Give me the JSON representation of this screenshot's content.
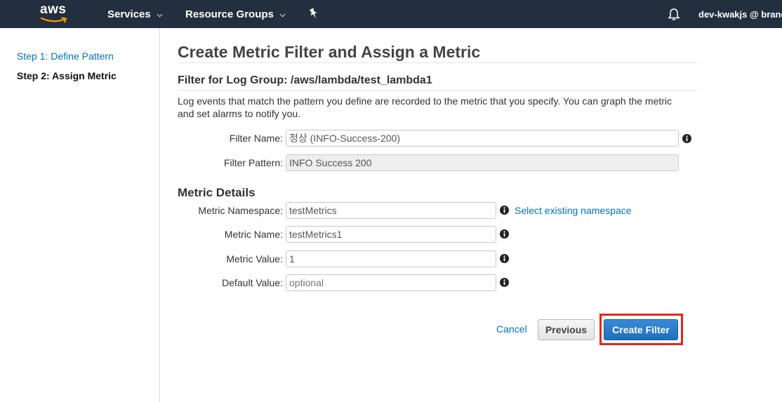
{
  "topnav": {
    "logo_text": "aws",
    "services_label": "Services",
    "resource_groups_label": "Resource Groups",
    "caret": "⌄",
    "account_label": "dev-kwakjs @ brand"
  },
  "sidebar": {
    "steps": [
      {
        "label": "Step 1: Define Pattern",
        "active": false
      },
      {
        "label": "Step 2: Assign Metric",
        "active": true
      }
    ]
  },
  "main": {
    "title": "Create Metric Filter and Assign a Metric",
    "subtitle": "Filter for Log Group: /aws/lambda/test_lambda1",
    "description": "Log events that match the pattern you define are recorded to the metric that you specify. You can graph the metric and set alarms to notify you.",
    "filter_name": {
      "label": "Filter Name:",
      "value": "정상 (INFO-Success-200)"
    },
    "filter_pattern": {
      "label": "Filter Pattern:",
      "value": "INFO Success 200"
    },
    "metric_details_title": "Metric Details",
    "metric_namespace": {
      "label": "Metric Namespace:",
      "value": "testMetrics",
      "link": "Select existing namespace"
    },
    "metric_name": {
      "label": "Metric Name:",
      "value": "testMetrics1"
    },
    "metric_value": {
      "label": "Metric Value:",
      "value": "1"
    },
    "default_value": {
      "label": "Default Value:",
      "value": "",
      "placeholder": "optional"
    }
  },
  "actions": {
    "cancel_label": "Cancel",
    "previous_label": "Previous",
    "create_label": "Create Filter",
    "highlight_color": "#e8231d"
  },
  "colors": {
    "nav_bg": "#232f3e",
    "link": "#0073bb",
    "primary_button": "#2a7ccc",
    "aws_orange": "#ff9900"
  }
}
